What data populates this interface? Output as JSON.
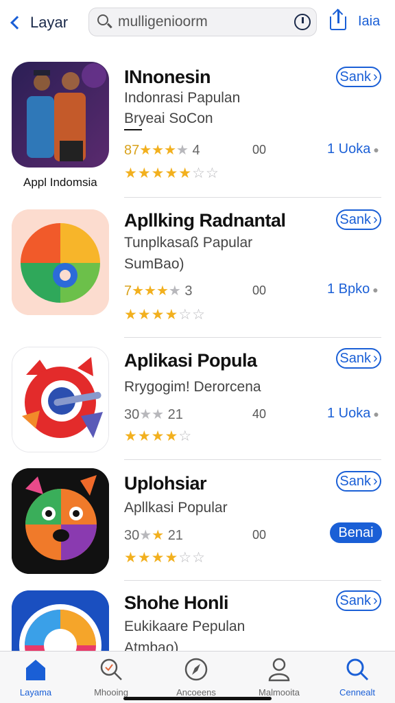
{
  "header": {
    "back_label": "Layar",
    "search_query": "mulligenioorm",
    "right_link": "Iaia"
  },
  "apps": [
    {
      "title": "INnonesin",
      "subtitle": "Indonrasi Papulan",
      "developer": "Bryeai SoCon",
      "rating_num": "87",
      "rating_count": "4",
      "mid": "00",
      "size": "1 Uoka",
      "stars": 4,
      "caption": "Appl Indomsia",
      "button": "Sank",
      "button_filled": false
    },
    {
      "title": "Apllking Radnantal",
      "subtitle": "Tunplkasaß Papular",
      "developer": "SumBao)",
      "rating_num": "7",
      "rating_count": "3",
      "mid": "00",
      "size": "1 Bpko",
      "stars": 4,
      "button": "Sank",
      "button_filled": false
    },
    {
      "title": "Aplikasi Popula",
      "subtitle": "Rrygogim! Derorcena",
      "rating_num": "30",
      "rating_count": "21",
      "mid": "40",
      "size": "1 Uoka",
      "stars": 4,
      "button": "Sank",
      "button_filled": false
    },
    {
      "title": "Uplohsiar",
      "subtitle": "Apllkasi Popular",
      "rating_num": "30",
      "rating_count": "21",
      "mid": "00",
      "size": "",
      "stars": 3,
      "button": "Sank",
      "button_filled": false,
      "action_button": "Benai"
    },
    {
      "title": "Shohe Honli",
      "subtitle": "Eukikaare Pepulan",
      "developer": "Atmbao)",
      "button": "Sank",
      "button_filled": false
    }
  ],
  "tabbar": [
    {
      "label": "Layama",
      "icon": "home-icon",
      "active": true
    },
    {
      "label": "Mhooing",
      "icon": "search-loop-icon",
      "active": false
    },
    {
      "label": "Ancoeens",
      "icon": "compass-icon",
      "active": false
    },
    {
      "label": "Malmooita",
      "icon": "person-icon",
      "active": false
    },
    {
      "label": "Cennealt",
      "icon": "search-icon",
      "active": true
    }
  ],
  "colors": {
    "accent": "#1a5fd6",
    "star": "#f2b01e",
    "divider": "#dcdcdf"
  }
}
